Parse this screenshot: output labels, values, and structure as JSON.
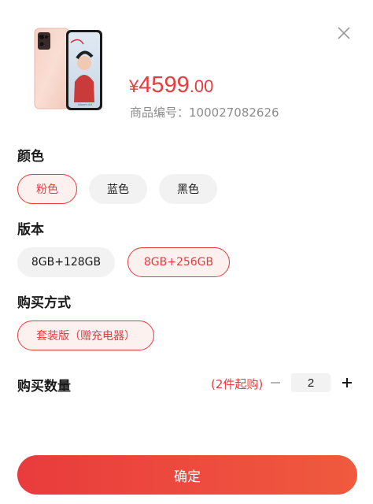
{
  "product": {
    "image": "phone-product-image",
    "price_symbol": "¥",
    "price_integer": "4599",
    "price_decimal": ".00",
    "sku_label": "商品编号：",
    "sku_value": "100027082626"
  },
  "sections": {
    "color": {
      "title": "颜色",
      "options": [
        "粉色",
        "蓝色",
        "黑色"
      ],
      "selected": "粉色"
    },
    "version": {
      "title": "版本",
      "options": [
        "8GB+128GB",
        "8GB+256GB"
      ],
      "selected": "8GB+256GB"
    },
    "purchase": {
      "title": "购买方式",
      "options": [
        "套装版（赠充电器）"
      ],
      "selected": "套装版（赠充电器）"
    },
    "quantity": {
      "title": "购买数量",
      "hint": "(2件起购)",
      "value": "2"
    }
  },
  "confirm_label": "确定",
  "colors": {
    "accent": "#e93b3d",
    "chip_bg": "#f2f2f2",
    "muted": "#8c8c8c"
  },
  "icons": {
    "close": "close-icon",
    "minus": "minus-icon",
    "plus": "plus-icon"
  }
}
